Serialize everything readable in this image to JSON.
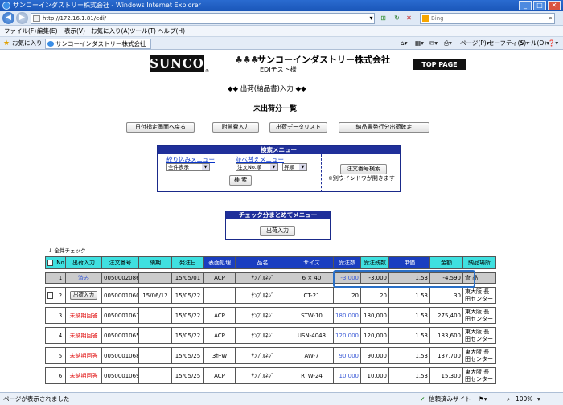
{
  "browser": {
    "title": "サンコーインダストリー株式会社 - Windows Internet Explorer",
    "address": "http://172.16.1.81/edi/",
    "search_placeholder": "Bing",
    "menu": [
      "ファイル(F)",
      "編集(E)",
      "表示(V)",
      "お気に入り(A)",
      "ツール(T)",
      "ヘルプ(H)"
    ],
    "favorites_label": "お気に入り",
    "tab_title": "サンコーインダストリー株式会社",
    "tools": [
      "ページ(P)▾",
      "セーフティ(S)▾",
      "ツール(O)▾",
      "❓▾"
    ],
    "status_text": "ページが表示されました",
    "zone_text": "信頼済みサイト",
    "zoom": "100%"
  },
  "header": {
    "logo": "SUNCO",
    "logo_mark": "®",
    "company": "サンコーインダストリー株式会社",
    "user": "EDIテスト様",
    "top_page": "TOP PAGE"
  },
  "page": {
    "heading": "◆◆ 出荷(納品書)入力 ◆◆",
    "subtitle": "未出荷分一覧",
    "buttons": [
      "日付指定画面へ戻る",
      "附帯費入力",
      "出荷データリスト",
      "納品書発行分出荷確定"
    ]
  },
  "search_menu": {
    "title": "検索メニュー",
    "filter_label": "絞り込みメニュー",
    "filter_value": "全件表示",
    "sort_label": "並べ替えメニュー",
    "sort_key": "注文No.順",
    "sort_order": "昇順",
    "search_button": "検 索",
    "order_search_button": "注文番号検索",
    "order_search_note": "※別ウインドウが開きます"
  },
  "check_menu": {
    "title": "チェック分まとめてメニュー",
    "ship_button": "出荷入力"
  },
  "table": {
    "check_all": "↓ 全件チェック",
    "headers": [
      "No",
      "出荷入力",
      "注文番号",
      "納期",
      "発注日",
      "表面処理",
      "品名",
      "サイズ",
      "受注数",
      "受注残数",
      "単価",
      "金額",
      "納品場所"
    ],
    "rows": [
      {
        "no": "1",
        "action": "済み",
        "order": "0050002086",
        "due": "",
        "ordered": "15/05/01",
        "surface": "ACP",
        "name": "ｻﾝﾌﾟﾙﾈｼﾞ",
        "size": "6 × 40",
        "qty": "-3,000",
        "remain": "-3,000",
        "price": "1.53",
        "amount": "-4,590",
        "place": "倉 品"
      },
      {
        "no": "2",
        "action": "出荷入力",
        "order": "0050001060",
        "due": "15/06/12",
        "ordered": "15/05/22",
        "surface": "",
        "name": "ｻﾝﾌﾟﾙﾈｼﾞ",
        "size": "CT-21",
        "qty": "20",
        "remain": "20",
        "price": "1.53",
        "amount": "30",
        "place": "東大阪 長田センター"
      },
      {
        "no": "3",
        "action": "未納期回答",
        "order": "0050001061",
        "due": "",
        "ordered": "15/05/22",
        "surface": "ACP",
        "name": "ｻﾝﾌﾟﾙﾈｼﾞ",
        "size": "STW-10",
        "qty": "180,000",
        "remain": "180,000",
        "price": "1.53",
        "amount": "275,400",
        "place": "東大阪 長田センター"
      },
      {
        "no": "4",
        "action": "未納期回答",
        "order": "0050001065",
        "due": "",
        "ordered": "15/05/22",
        "surface": "ACP",
        "name": "ｻﾝﾌﾟﾙﾈｼﾞ",
        "size": "USN-4043",
        "qty": "120,000",
        "remain": "120,000",
        "price": "1.53",
        "amount": "183,600",
        "place": "東大阪 長田センター"
      },
      {
        "no": "5",
        "action": "未納期回答",
        "order": "0050001068",
        "due": "",
        "ordered": "15/05/25",
        "surface": "3ｶｰW",
        "name": "ｻﾝﾌﾟﾙﾈｼﾞ",
        "size": "AW-7",
        "qty": "90,000",
        "remain": "90,000",
        "price": "1.53",
        "amount": "137,700",
        "place": "東大阪 長田センター"
      },
      {
        "no": "6",
        "action": "未納期回答",
        "order": "0050001069",
        "due": "",
        "ordered": "15/05/25",
        "surface": "ACP",
        "name": "ｻﾝﾌﾟﾙﾈｼﾞ",
        "size": "RTW-24",
        "qty": "10,000",
        "remain": "10,000",
        "price": "1.53",
        "amount": "15,300",
        "place": "東大阪 長田センター"
      }
    ]
  },
  "colors": {
    "header_cyan": "#3fe0e0",
    "header_blue": "#1a3ec0",
    "panel_blue": "#1f2f9a",
    "alert_red": "#e01010",
    "link_blue": "#0a36c8"
  }
}
